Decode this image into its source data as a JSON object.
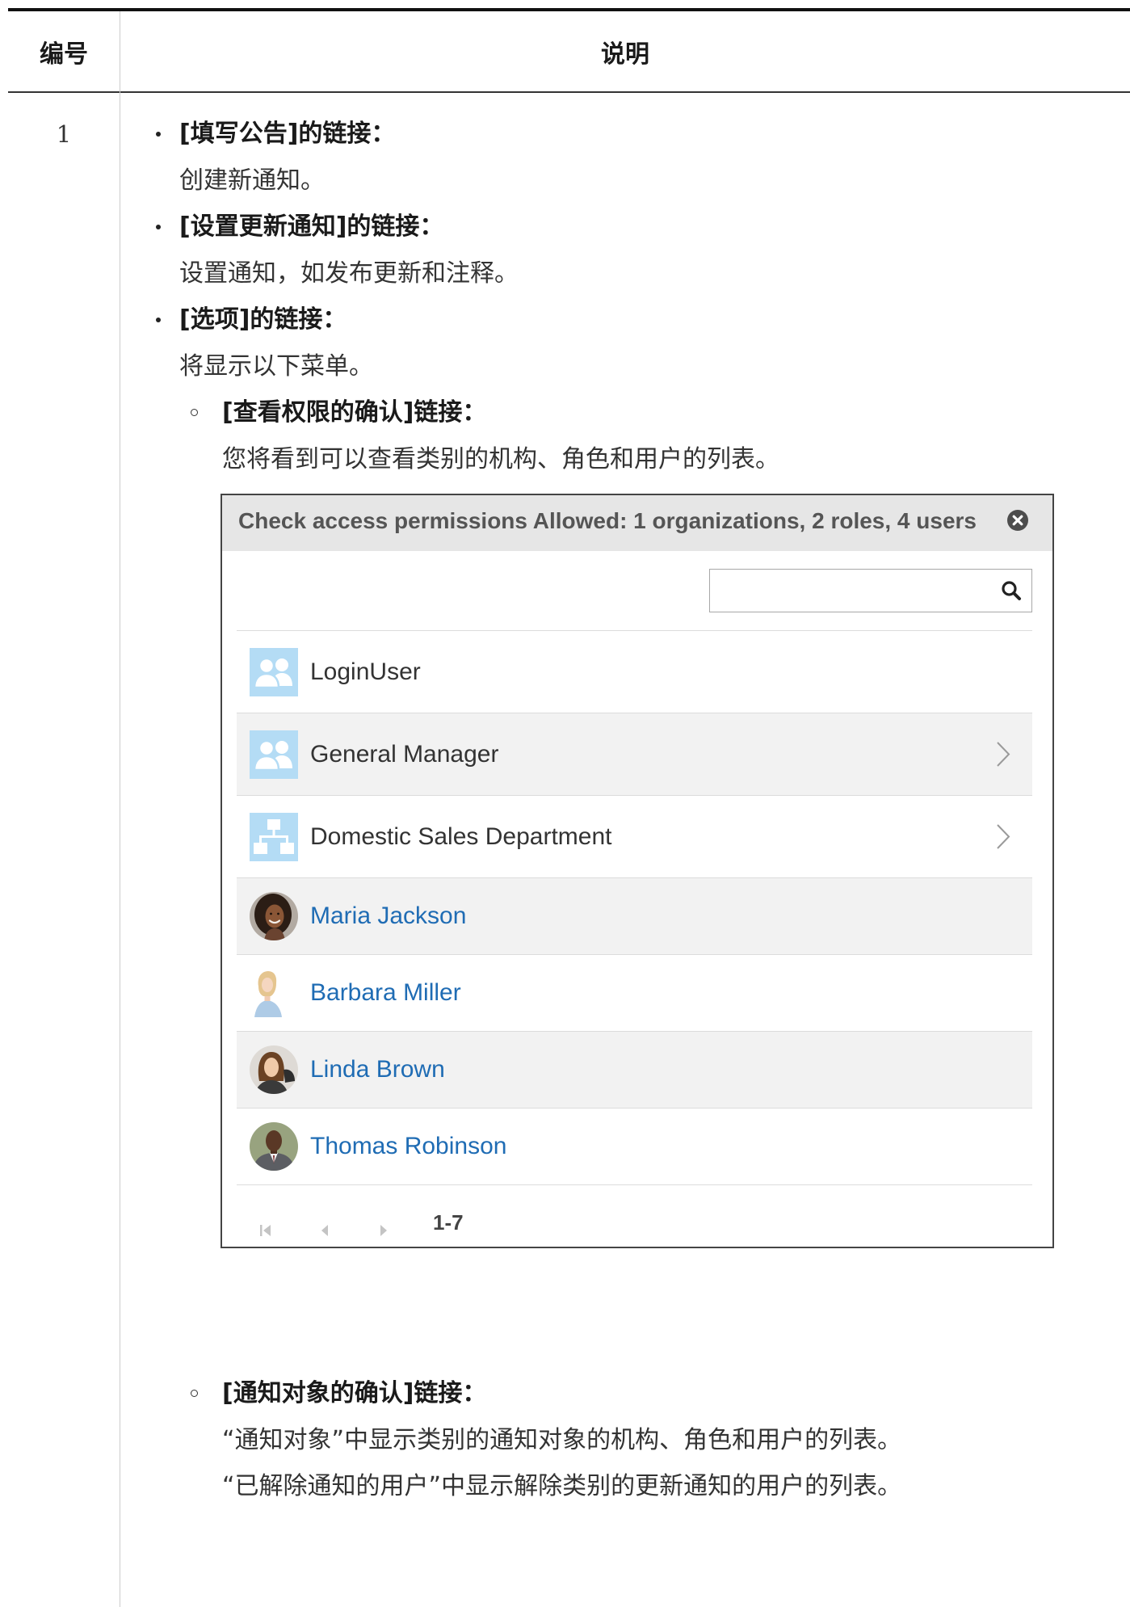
{
  "table": {
    "header_number": "编号",
    "header_description": "说明"
  },
  "row": {
    "number": "1",
    "bullets": [
      {
        "title": "[填写公告]的链接：",
        "text": "创建新通知。"
      },
      {
        "title": "[设置更新通知]的链接：",
        "text": "设置通知，如发布更新和注释。"
      },
      {
        "title": "[选项]的链接：",
        "text": "将显示以下菜单。"
      }
    ],
    "sub_bullets": [
      {
        "title": "[查看权限的确认]链接：",
        "lines": [
          "您将看到可以查看类别的机构、角色和用户的列表。"
        ]
      },
      {
        "title": "[通知对象的确认]链接：",
        "lines": [
          "“通知对象”中显示类别的通知对象的机构、角色和用户的列表。",
          "“已解除通知的用户”中显示解除类别的更新通知的用户的列表。"
        ]
      }
    ]
  },
  "dialog": {
    "title": "Check access permissions Allowed: 1 organizations, 2 roles, 4 users",
    "close_icon": "close-icon",
    "search": {
      "value": "",
      "placeholder": "",
      "icon": "search-icon"
    },
    "entries": [
      {
        "name": "LoginUser",
        "icon": "role-icon"
      },
      {
        "name": "General Manager",
        "icon": "role-icon",
        "chevron": "chevron-right-icon"
      },
      {
        "name": "Domestic Sales Department",
        "icon": "organization-icon",
        "chevron": "chevron-right-icon"
      },
      {
        "name": "Maria Jackson",
        "icon": "user-photo-avatar"
      },
      {
        "name": "Barbara Miller",
        "icon": "user-photo-avatar"
      },
      {
        "name": "Linda Brown",
        "icon": "user-photo-avatar"
      },
      {
        "name": "Thomas Robinson",
        "icon": "user-photo-avatar"
      }
    ],
    "pagination": {
      "first_icon": "first-page-icon",
      "prev_icon": "previous-page-icon",
      "next_icon": "next-page-icon",
      "range": "1-7"
    }
  },
  "colors": {
    "table_rule": "#111111",
    "header_rule": "#333333",
    "column_divider": "#cccccc",
    "dialog_border": "#444444",
    "dialog_header_bg": "#e6e6e6",
    "stripe_bg": "#f2f2f2",
    "row_border": "#dcdcdc",
    "icon_bg": "#b4dcf5",
    "link": "#1f6cb4",
    "muted_icon": "#c4c4c4"
  }
}
